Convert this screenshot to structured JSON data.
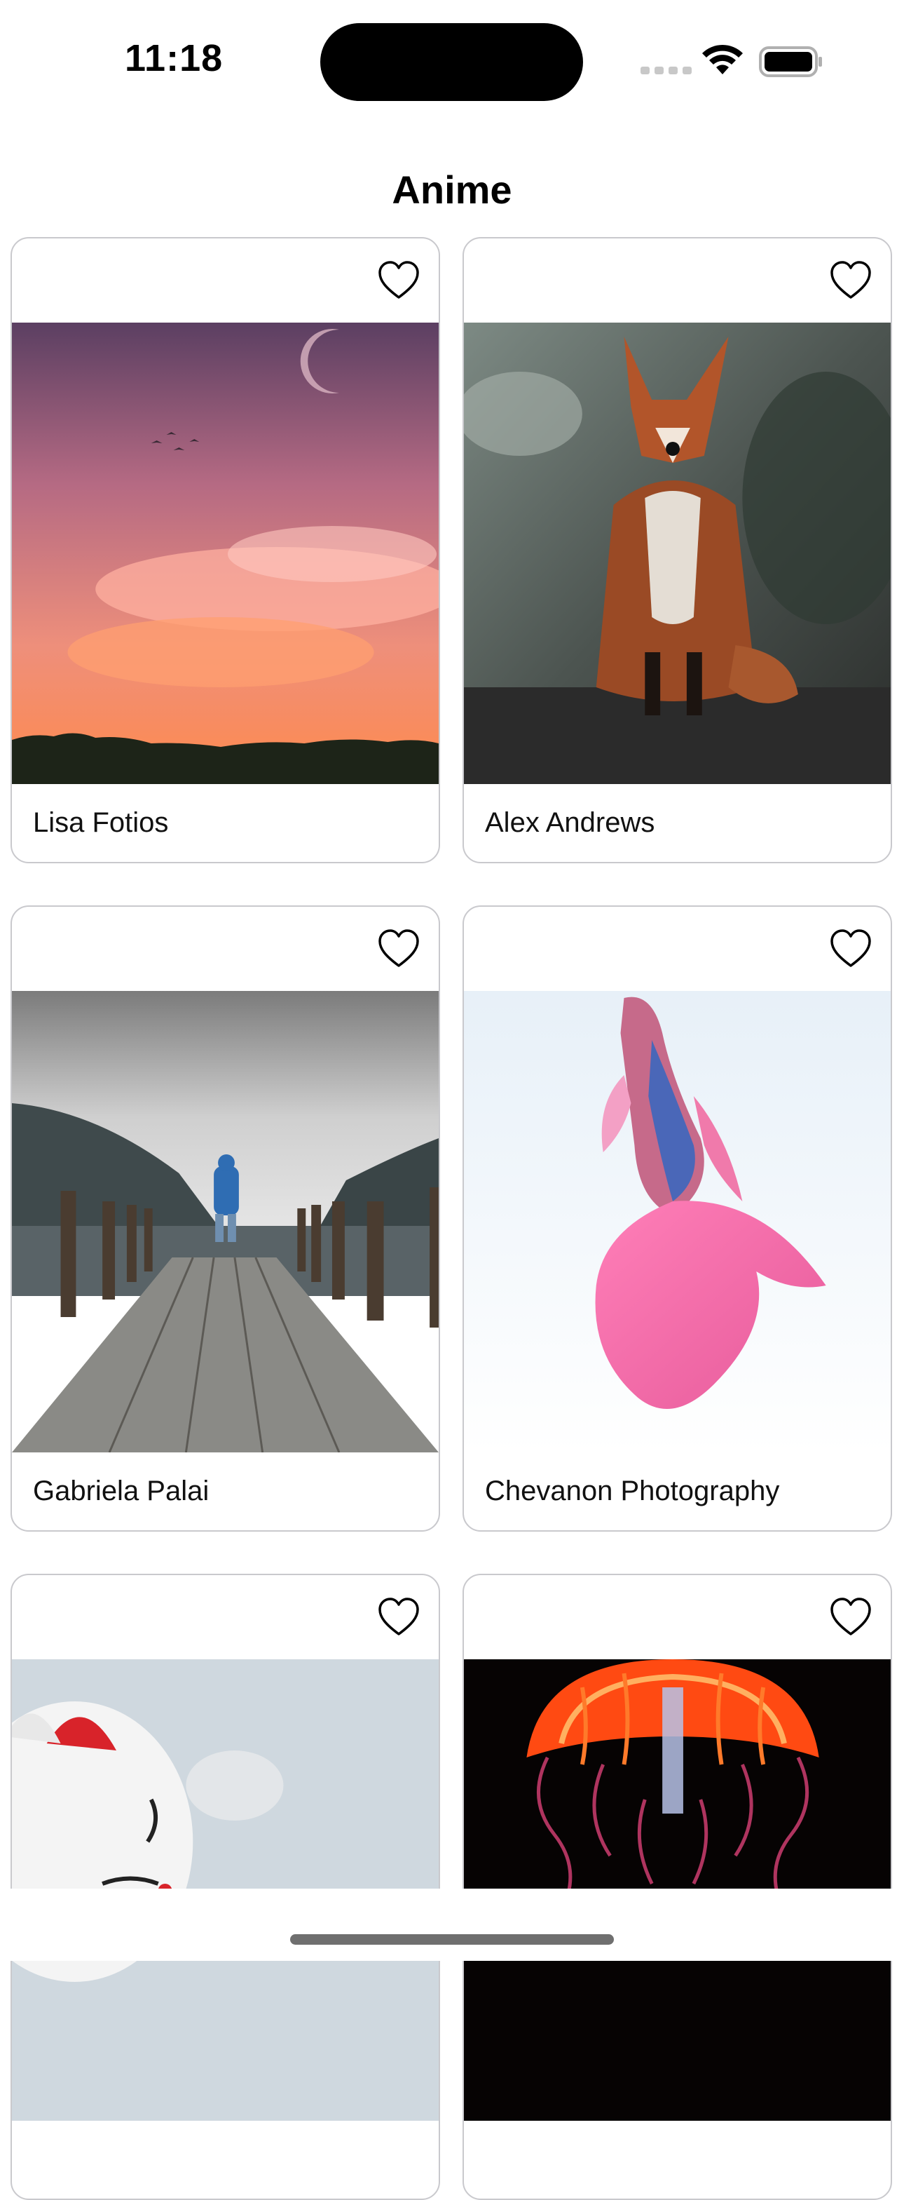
{
  "status_bar": {
    "time": "11:18"
  },
  "header": {
    "title": "Anime"
  },
  "cards": [
    {
      "author": "Lisa Fotios",
      "image": "sunset-sky-photo",
      "liked": false
    },
    {
      "author": "Alex Andrews",
      "image": "fox-photo",
      "liked": false
    },
    {
      "author": "Gabriela Palai",
      "image": "pier-lake-photo",
      "liked": false
    },
    {
      "author": "Chevanon Photography",
      "image": "betta-fish-photo",
      "liked": false
    },
    {
      "author": "",
      "image": "lucky-cat-photo",
      "liked": false
    },
    {
      "author": "",
      "image": "glowing-jellyfish-photo",
      "liked": false
    }
  ],
  "icons": {
    "favorite": "heart-outline-icon",
    "wifi": "wifi-icon",
    "battery": "battery-icon",
    "signal": "cellular-signal-icon"
  }
}
